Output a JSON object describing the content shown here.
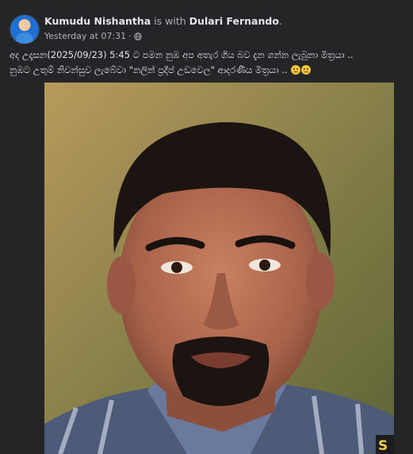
{
  "header": {
    "author": "Kumudu Nishantha",
    "with_text": "is with",
    "tagged": "Dulari Fernando",
    "timestamp": "Yesterday at 07:31",
    "separator": "·",
    "privacy_icon": "globe-icon"
  },
  "post": {
    "line1": "අද උදෑසන(2025/09/23) 5:45 ට පමන නුඹ අප අතැර ගිය බව දැන ගන්න ලැබුනා මිත්‍රයා ..",
    "line2": "නුඹට උතුම් නිවන්සුව ලැබේවා \"නලින් ප්‍රදීප් උඩවෙල\" ආදරණීය මිත්‍රයා ..",
    "emoji": "sad-face-emoji"
  },
  "photo": {
    "subject": "portrait-photo",
    "watermark": "S"
  },
  "colors": {
    "background": "#242526",
    "text_primary": "#e4e6eb",
    "text_secondary": "#b0b3b8"
  }
}
